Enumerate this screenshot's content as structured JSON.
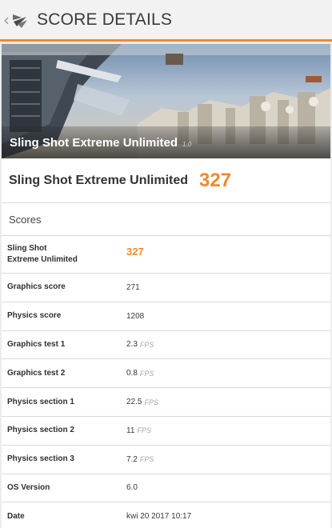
{
  "appbar": {
    "back_glyph": "‹",
    "logo_icon": "3dmark-logo-icon",
    "title": "SCORE DETAILS"
  },
  "hero": {
    "title": "Sling Shot Extreme Unlimited",
    "version": "1.0"
  },
  "summary": {
    "name": "Sling Shot Extreme Unlimited",
    "score": "327"
  },
  "scores": {
    "heading": "Scores",
    "rows": [
      {
        "label": "Sling Shot\nExtreme Unlimited",
        "value": "327",
        "unit": ""
      },
      {
        "label": "Graphics score",
        "value": "271",
        "unit": ""
      },
      {
        "label": "Physics score",
        "value": "1208",
        "unit": ""
      },
      {
        "label": "Graphics test 1",
        "value": "2.3",
        "unit": "FPS"
      },
      {
        "label": "Graphics test 2",
        "value": "0.8",
        "unit": "FPS"
      },
      {
        "label": "Physics section 1",
        "value": "22.5",
        "unit": "FPS"
      },
      {
        "label": "Physics section 2",
        "value": "11",
        "unit": "FPS"
      },
      {
        "label": "Physics section 3",
        "value": "7.2",
        "unit": "FPS"
      },
      {
        "label": "OS Version",
        "value": "6.0",
        "unit": ""
      },
      {
        "label": "Date",
        "value": "kwi 20 2017 10:17",
        "unit": ""
      }
    ]
  },
  "colors": {
    "accent": "#f08a2c",
    "appbar_bg": "#f2f2f2"
  }
}
